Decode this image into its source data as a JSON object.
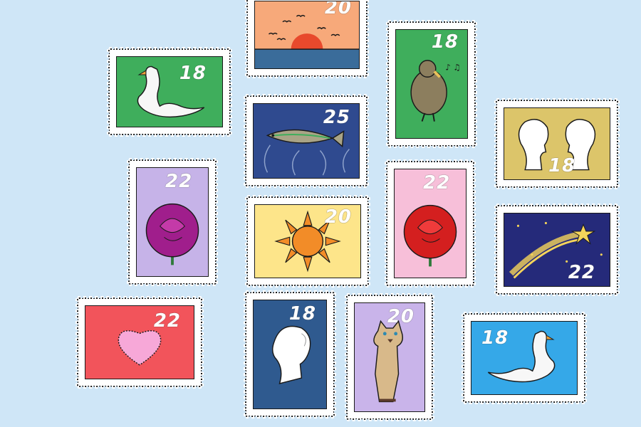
{
  "background": "#cfe6f7",
  "stamps": [
    {
      "id": "sunset",
      "value": "20",
      "panel": "#f7a97a",
      "icon": "sunset-icon"
    },
    {
      "id": "swan-green",
      "value": "18",
      "panel": "#3fae5c",
      "icon": "swan-icon"
    },
    {
      "id": "kiwi-bird",
      "value": "18",
      "panel": "#3fae5c",
      "icon": "bird-icon"
    },
    {
      "id": "fish",
      "value": "25",
      "panel": "#2f4a8f",
      "icon": "fish-icon"
    },
    {
      "id": "two-heads",
      "value": "18",
      "panel": "#dcc56a",
      "icon": "silhouette-pair-icon"
    },
    {
      "id": "rose-purple",
      "value": "22",
      "panel": "#c6b3e8",
      "icon": "rose-icon"
    },
    {
      "id": "sun",
      "value": "20",
      "panel": "#fde58a",
      "icon": "sun-icon"
    },
    {
      "id": "rose-red",
      "value": "22",
      "panel": "#f7bfd9",
      "icon": "rose-icon"
    },
    {
      "id": "shooting-star",
      "value": "22",
      "panel": "#252a7a",
      "icon": "shooting-star-icon"
    },
    {
      "id": "heart",
      "value": "22",
      "panel": "#f2545b",
      "icon": "heart-icon"
    },
    {
      "id": "head-blue",
      "value": "18",
      "panel": "#2f5a8f",
      "icon": "silhouette-icon"
    },
    {
      "id": "cat",
      "value": "20",
      "panel": "#c9b4ea",
      "icon": "cat-icon"
    },
    {
      "id": "swan-blue",
      "value": "18",
      "panel": "#35a8e8",
      "icon": "swan-icon"
    }
  ]
}
